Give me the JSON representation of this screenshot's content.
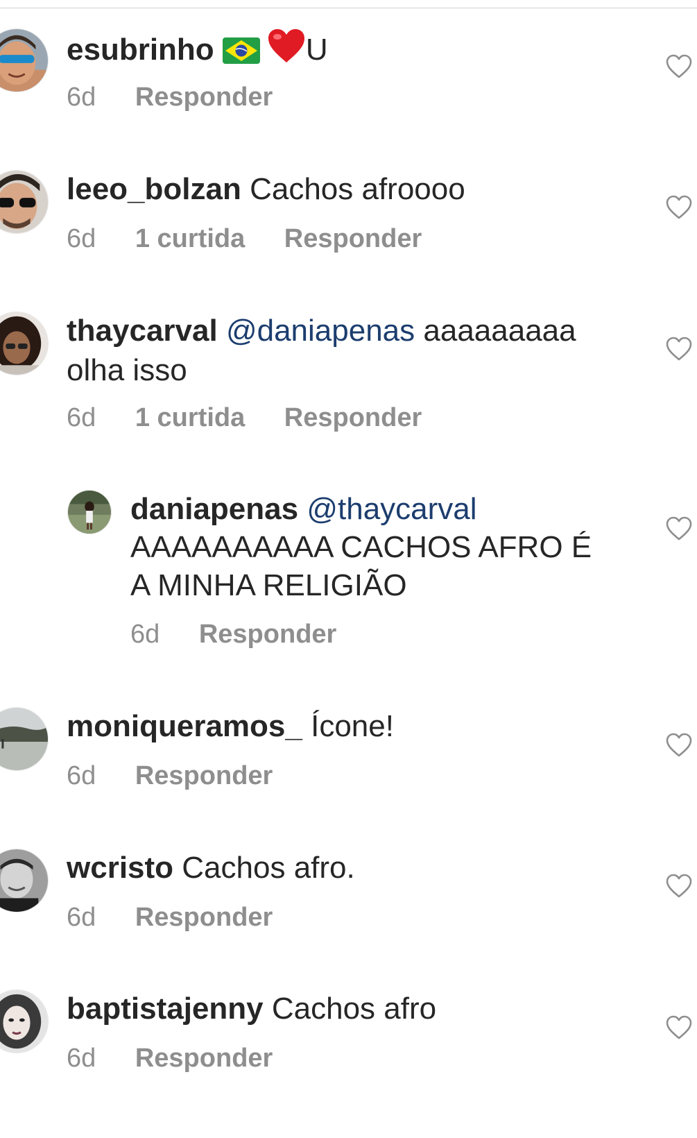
{
  "comments": [
    {
      "username": "esubrinho",
      "text_suffix": "U",
      "time": "6d",
      "reply_label": "Responder"
    },
    {
      "username": "leeo_bolzan",
      "text": "Cachos afroooo",
      "time": "6d",
      "likes": "1 curtida",
      "reply_label": "Responder"
    },
    {
      "username": "thaycarval",
      "mention": "@daniapenas",
      "text": "aaaaaaaaa olha isso",
      "time": "6d",
      "likes": "1 curtida",
      "reply_label": "Responder"
    },
    {
      "username": "daniapenas",
      "mention": "@thaycarval",
      "text": "AAAAAAAAAA CACHOS AFRO É A MINHA RELIGIÃO",
      "time": "6d",
      "reply_label": "Responder"
    },
    {
      "username": "moniqueramos_",
      "text": "Ícone!",
      "time": "6d",
      "reply_label": "Responder"
    },
    {
      "username": "wcristo",
      "text": "Cachos afro.",
      "time": "6d",
      "reply_label": "Responder"
    },
    {
      "username": "baptistajenny",
      "text": "Cachos afro",
      "time": "6d",
      "reply_label": "Responder"
    }
  ],
  "colors": {
    "text": "#262626",
    "meta": "#8e8e8e",
    "mention": "#1c3d6e",
    "heart_outline": "#8e8e8e"
  },
  "icons": {
    "like": "heart-outline-icon",
    "flag": "brazil-flag-emoji",
    "heart_emoji": "red-heart-emoji"
  }
}
